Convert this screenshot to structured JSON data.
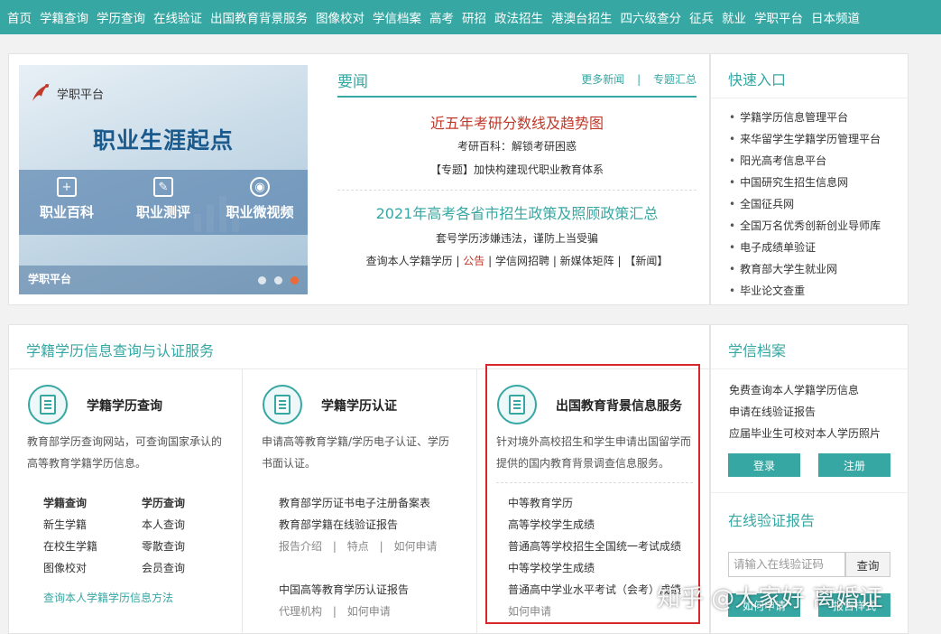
{
  "nav": [
    "首页",
    "学籍查询",
    "学历查询",
    "在线验证",
    "出国教育背景服务",
    "图像校对",
    "学信档案",
    "高考",
    "研招",
    "政法招生",
    "港澳台招生",
    "四六级查分",
    "征兵",
    "就业",
    "学职平台",
    "日本频道"
  ],
  "banner": {
    "logo_text": "学职平台",
    "headline": "职业生涯起点",
    "tiles": [
      "职业百科",
      "职业测评",
      "职业微视频"
    ],
    "footer_label": "学职平台"
  },
  "news": {
    "title": "要闻",
    "more": "更多新闻",
    "topics": "专题汇总",
    "headline1": "近五年考研分数线及趋势图",
    "sub1": "考研百科：解锁考研困惑",
    "sub2": "【专题】加快构建现代职业教育体系",
    "headline2": "2021年高考各省市招生政策及照顾政策汇总",
    "sub3": "套号学历涉嫌违法，谨防上当受骗",
    "links": [
      "查询本人学籍学历",
      "公告",
      "学信网招聘",
      "新媒体矩阵",
      "【新闻】"
    ]
  },
  "quick": {
    "title": "快速入口",
    "items": [
      "学籍学历信息管理平台",
      "来华留学生学籍学历管理平台",
      "阳光高考信息平台",
      "中国研究生招生信息网",
      "全国征兵网",
      "全国万名优秀创新创业导师库",
      "电子成绩单验证",
      "教育部大学生就业网",
      "毕业论文查重"
    ]
  },
  "service": {
    "title": "学籍学历信息查询与认证服务",
    "col1": {
      "title": "学籍学历查询",
      "desc1": "教育部学历查询网站，可查询国家承认的",
      "desc2": "高等教育学籍学历信息。",
      "head_a": "学籍查询",
      "head_b": "学历查询",
      "a": [
        "新生学籍",
        "在校生学籍",
        "图像校对"
      ],
      "b": [
        "本人查询",
        "零散查询",
        "会员查询"
      ],
      "link": "查询本人学籍学历信息方法"
    },
    "col2": {
      "title": "学籍学历认证",
      "desc1": "申请高等教育学籍/学历电子认证、学历",
      "desc2": "书面认证。",
      "items": [
        "教育部学历证书电子注册备案表",
        "教育部学籍在线验证报告"
      ],
      "subs1": [
        "报告介绍",
        "特点",
        "如何申请"
      ],
      "item3": "中国高等教育学历认证报告",
      "subs2": [
        "代理机构",
        "如何申请"
      ]
    },
    "col3": {
      "title": "出国教育背景信息服务",
      "desc1": "针对境外高校招生和学生申请出国留学而",
      "desc2": "提供的国内教育背景调查信息服务。",
      "items": [
        "中等教育学历",
        "高等学校学生成绩",
        "普通高等学校招生全国统一考试成绩",
        "中等学校学生成绩",
        "普通高中学业水平考试（会考）成绩"
      ],
      "apply": "如何申请"
    }
  },
  "archive": {
    "title": "学信档案",
    "items": [
      "免费查询本人学籍学历信息",
      "申请在线验证报告",
      "应届毕业生可校对本人学历照片"
    ],
    "login": "登录",
    "register": "注册"
  },
  "verify": {
    "title": "在线验证报告",
    "placeholder": "请输入在线验证码",
    "button": "查询",
    "btn_a": "如何申请",
    "btn_b": "报告样式"
  },
  "watermark": "知乎 @大家好 离婚证",
  "colors": {
    "accent": "#37a7a3",
    "headline_red": "#c0392b",
    "highlight_box": "#d8262d"
  }
}
